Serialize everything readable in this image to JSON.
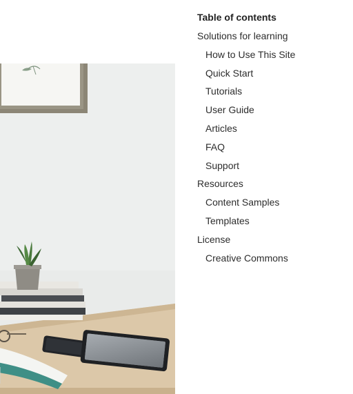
{
  "toc": {
    "title": "Table of contents",
    "sections": [
      {
        "label": "Solutions for learning",
        "children": [
          "How to Use This Site",
          "Quick Start",
          "Tutorials",
          "User Guide",
          "Articles",
          "FAQ",
          "Support"
        ]
      },
      {
        "label": "Resources",
        "children": [
          "Content Samples",
          "Templates"
        ]
      },
      {
        "label": "License",
        "children": [
          "Creative Commons"
        ]
      }
    ]
  }
}
